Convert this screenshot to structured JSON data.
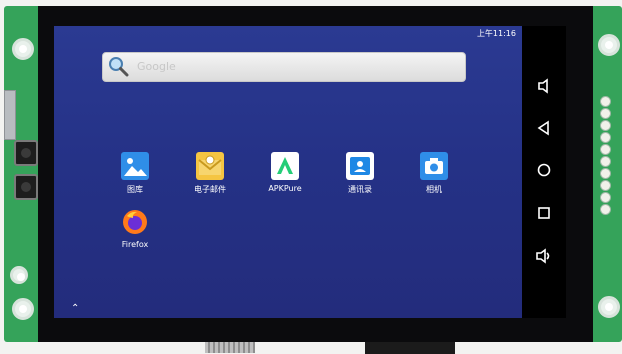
{
  "status_bar": {
    "time": "上午11:16"
  },
  "search": {
    "placeholder": "Google"
  },
  "apps": [
    {
      "label": "图库",
      "icon": "gallery-icon"
    },
    {
      "label": "电子邮件",
      "icon": "email-icon"
    },
    {
      "label": "APKPure",
      "icon": "apkpure-icon"
    },
    {
      "label": "通讯录",
      "icon": "contacts-icon"
    },
    {
      "label": "相机",
      "icon": "camera-icon"
    },
    {
      "label": "Firefox",
      "icon": "firefox-icon"
    }
  ],
  "navbar": [
    "volume-down-icon",
    "back-icon",
    "home-icon",
    "recents-icon",
    "volume-up-icon"
  ],
  "colors": {
    "pcb": "#35a35a",
    "wallpaper": "#27338a",
    "navbar": "#000000"
  }
}
